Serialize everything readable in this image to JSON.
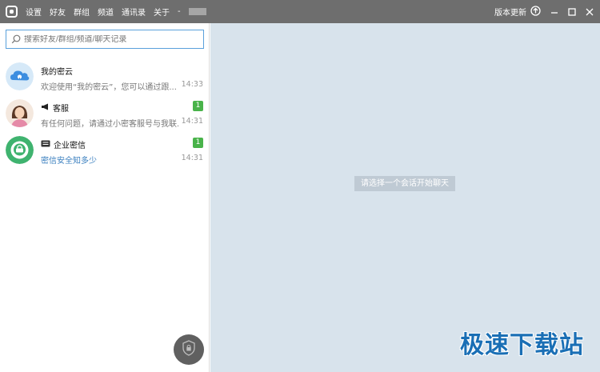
{
  "titlebar": {
    "menu": [
      "设置",
      "好友",
      "群组",
      "频道",
      "通讯录",
      "关于",
      "-"
    ],
    "update_label": "版本更新"
  },
  "search": {
    "placeholder": "搜索好友/群组/频道/聊天记录"
  },
  "conversations": [
    {
      "name": "我的密云",
      "preview": "欢迎使用“我的密云”，您可以通过跟...",
      "time": "14:33",
      "badge": ""
    },
    {
      "name": "客服",
      "preview": "有任何问题，请通过小密客服号与我联...",
      "time": "14:31",
      "badge": "1"
    },
    {
      "name": "企业密信",
      "preview": "密信安全知多少",
      "time": "14:31",
      "badge": "1"
    }
  ],
  "main": {
    "hint": "请选择一个会话开始聊天"
  },
  "watermark": "极速下载站",
  "colors": {
    "titlebar": "#6e6e6e",
    "chat_bg": "#d8e3ec",
    "badge": "#49b34a",
    "link": "#3a7fbf",
    "watermark": "#1a6fb5"
  }
}
